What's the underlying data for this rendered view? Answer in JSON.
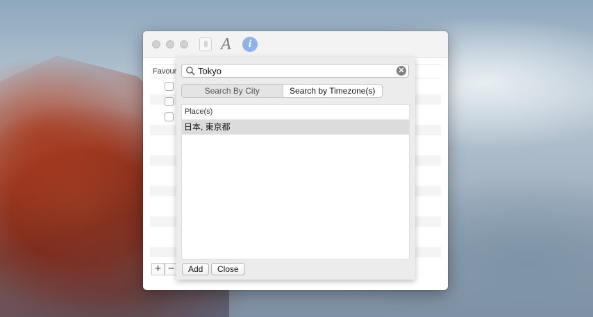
{
  "desktop": {
    "wallpaper": "mountain-cliff-wallpaper"
  },
  "window": {
    "toolbar": {
      "icons": [
        "phone-icon",
        "font-icon",
        "info-icon"
      ],
      "font_glyph": "A",
      "info_glyph": "i"
    },
    "back_table": {
      "header_label": "Favour",
      "checkbox_rows": 3,
      "add_label": "+",
      "remove_label": "−"
    }
  },
  "sheet": {
    "search": {
      "value": "Tokyo",
      "clear_glyph": "✕"
    },
    "segments": [
      {
        "label": "Search By City",
        "selected": false
      },
      {
        "label": "Search by Timezone(s)",
        "selected": true
      }
    ],
    "table": {
      "header": "Place(s)",
      "rows": [
        "日本, 東京都"
      ]
    },
    "buttons": {
      "add": "Add",
      "close": "Close"
    }
  },
  "colors": {
    "window_bg": "#ffffff",
    "toolbar_bg": "#f3f3f3",
    "sheet_bg": "#ececec",
    "selected_row": "#dcdcdc",
    "info_icon": "#8fb3e8"
  }
}
